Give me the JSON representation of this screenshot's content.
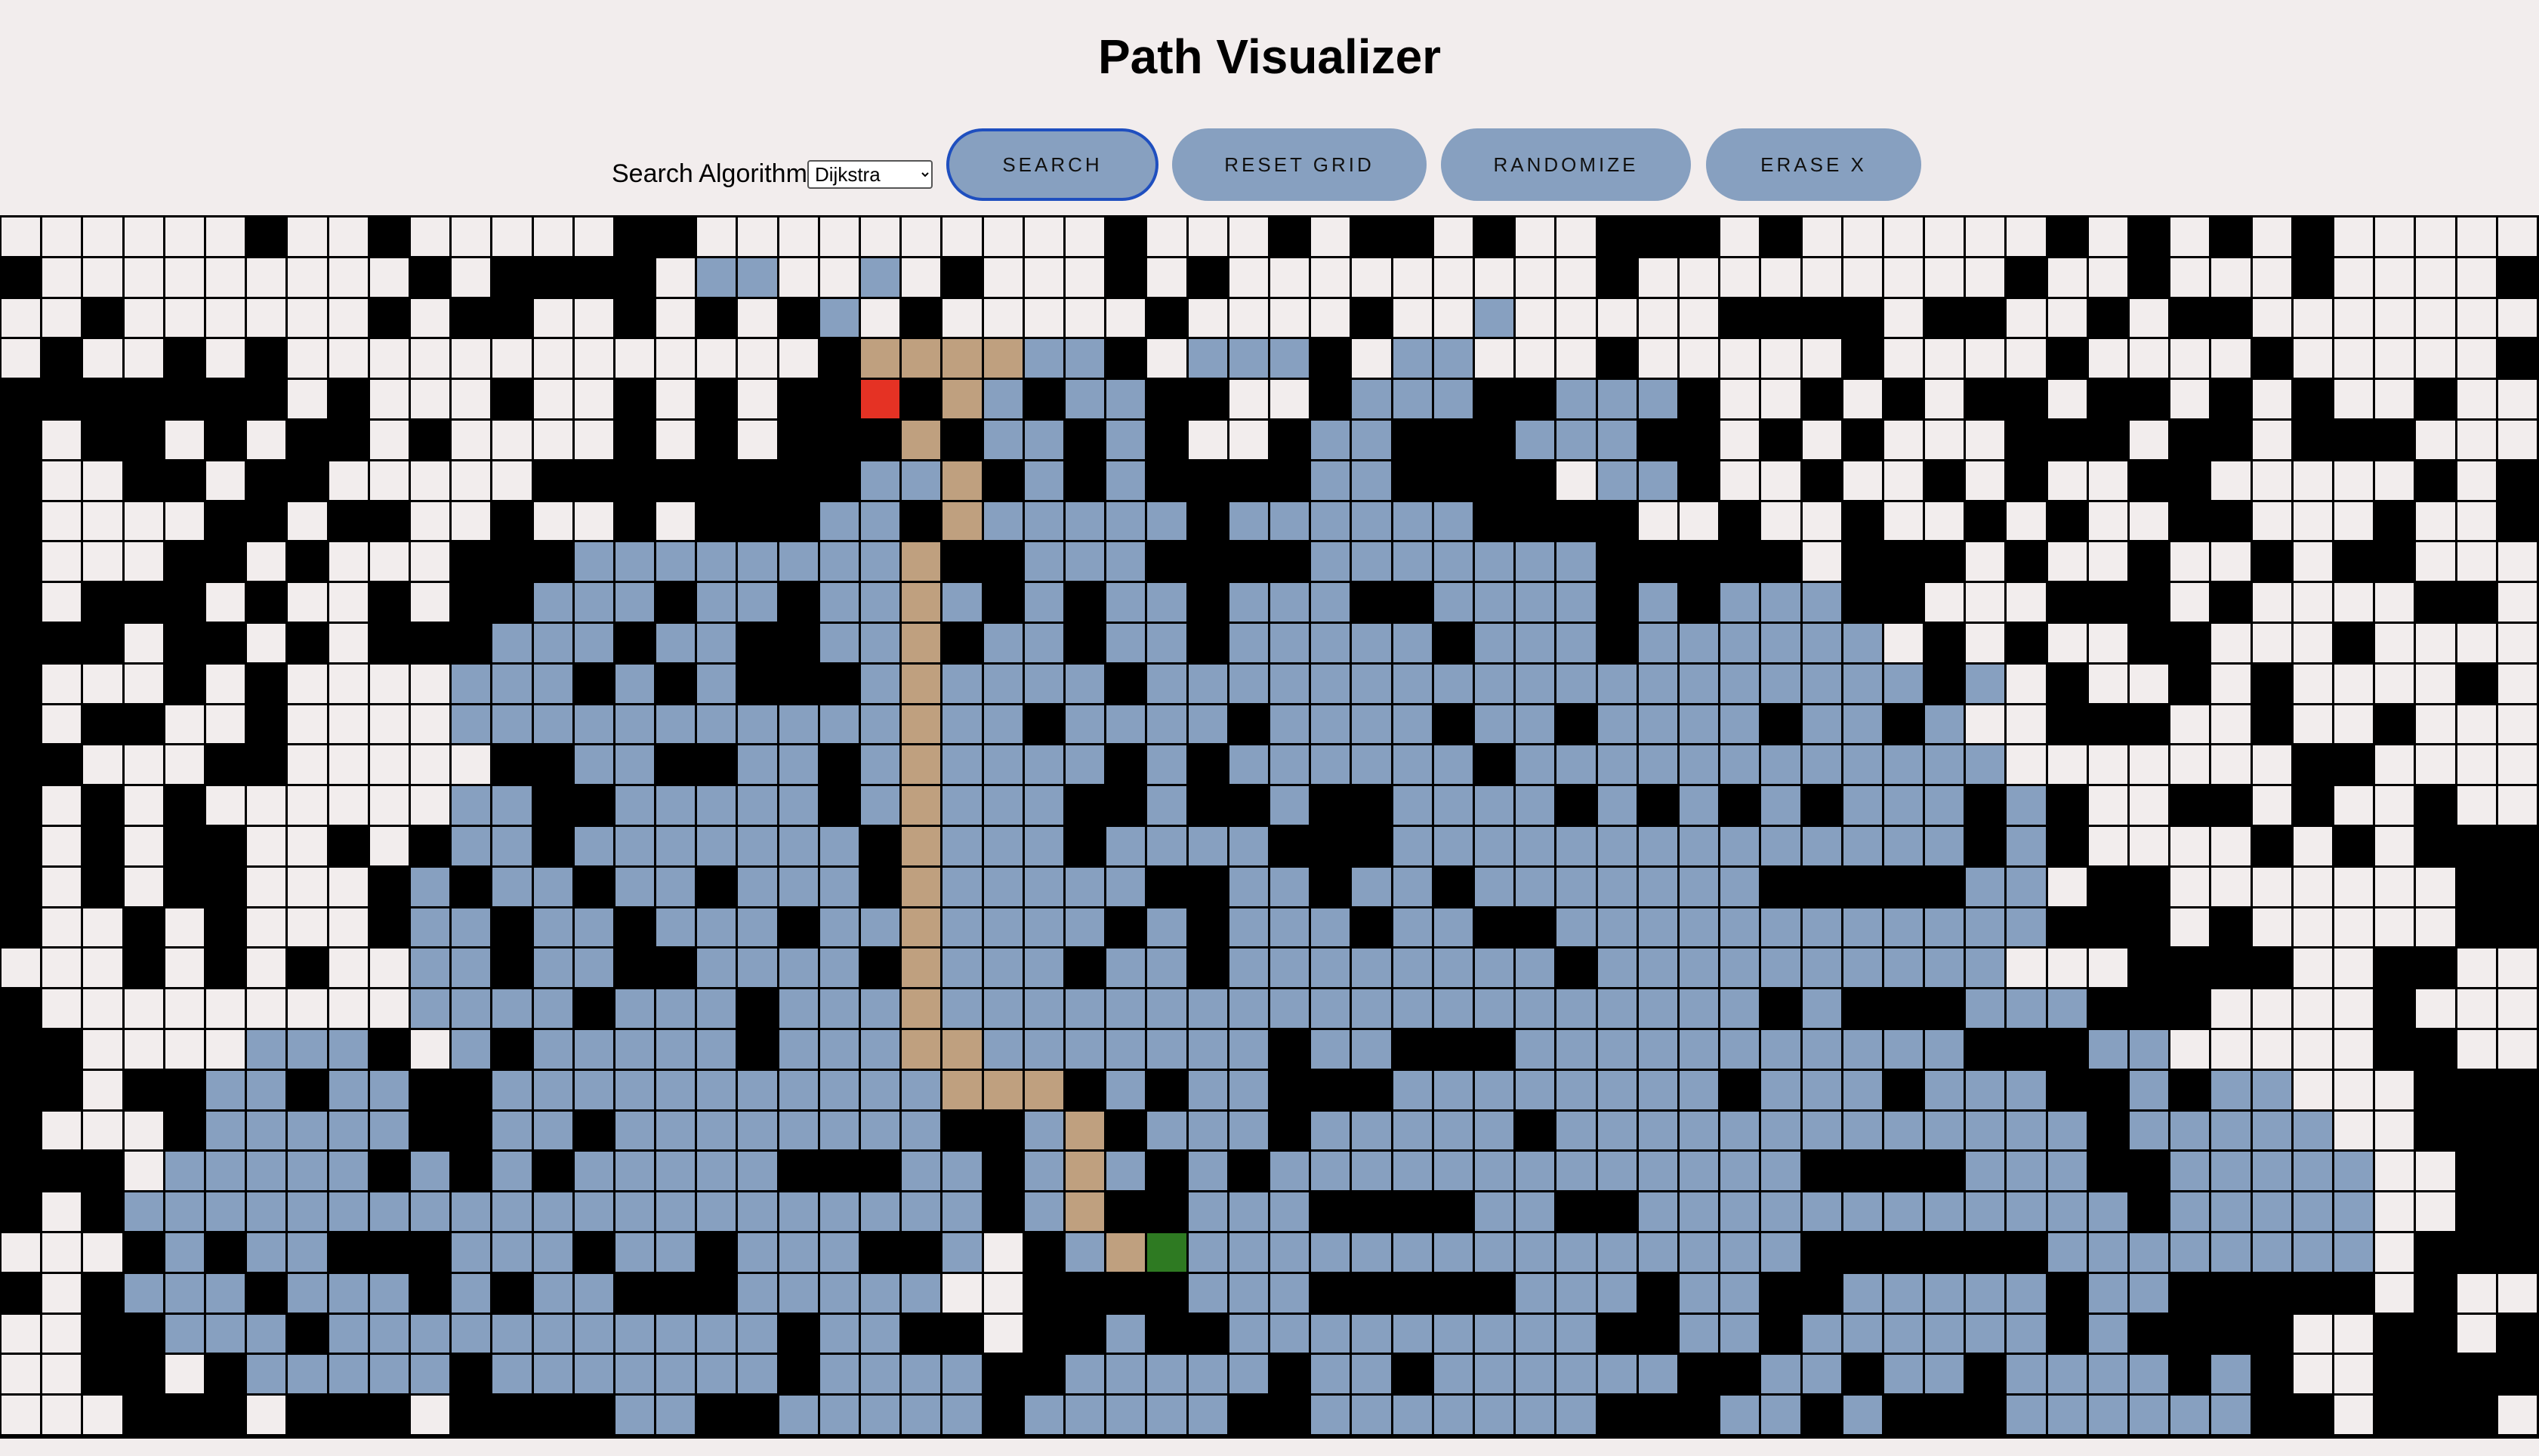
{
  "title": "Path Visualizer",
  "controls": {
    "algorithm_label": "Search Algorithm:",
    "algorithm_selected": "Dijkstra",
    "search_label": "SEARCH",
    "reset_label": "RESET GRID",
    "randomize_label": "RANDOMIZE",
    "erase_label": "ERASE X"
  },
  "legend_colors": {
    "empty": "#f2eded",
    "wall": "#000000",
    "visited": "#87a0c0",
    "path": "#bfa07f",
    "start": "#e53224",
    "target": "#2e7a22",
    "button": "#87a0c0"
  },
  "grid": {
    "columns": 62,
    "rows": 30,
    "cells": [
      "......#..#.....ww..........W...W.WW.W..WWW.W......W.W.W.W.....",
      "W.........W.WWWW.VV..V.W...W.W.........W.........W..W...W....W",
      "..W......W.WW..W.W.WV.W.....W....W..V.....WWWW.WW..W.WW.......",
      ".W..W.W.............WppppVVW.VVVW.VV...W.....W....W....W.....W.",
      "WWWWWWW.W...W..W.W.WWsWpVWVVWW..WVVVWWVVVW..W.W.WW.WW.W.W..W..",
      "W.WW.W.WW.W....W.W.WWWpWVVWVW..WVVWWWVVVWW.W.W...WWW.WW.WWW...",
      "W..WW.WW.....WWWWWWWWVVpWVWVWWWWVVWWWW.VVW..W..W.W..WW.....W.W",
      "W....WW.WW..W..W.WWWVVWpVVVVVWVVVVVVWWWW..W..W..W.W..WW...W..W",
      "W...WW.W...WWWVVVVVVVVpWWVVVWWWWVVVVVVVWWWWW.WWW.W..W..W.WW...",
      "W.WWW.W..W.WWVVVWVVWVVpVWVWVVWVVVWWVVVVWVWVVVWW...WWW.W....WW.",
      "WWW.WW.W.WWWVVVWVVWWVVpWVVWVVWVVVVVWVVVWVVVVVV.W.W..WW...W....",
      "W...W.W....VVVWVWVWWWVpVVVVWVVVVVVVVVVVVVVVVVVVWV.W..W.W....W.",
      "W.WW..W....VVVVVVVVVVVpVVWVVVVWVVVVWVVWVVVVWVVWV..WWW..W..W...",
      "WW...WW.....WWVVWWVVWVpVVVVWVWVVVVVVWVVVVVVVVVVVV.......WW....",
      "W.W.W......VVWWVVVVVWVpVVVWWVWWVWWVVVVWVWVWVWVVVWVW..WW.W..W..",
      "W.W.WW..W.WVVWVVVVVVVWpVVVWVVVVWWWVVVVVVVVVVVVVVWVW....W.W.WWW",
      "W.W.WW...WVWVVWVVWVVVWpVVVVVWWVVWVVWVVVVVVVWWWWWVV.WW.......WW",
      "W..W.W...WVVWVVWVVVWVVpVVVVWVWVVVWVVWWVVVVVVVVVVVVWWW.W.....WW",
      "...W.W.W..VVWVVWWVVVVWpVVVWVVWVVVVVVVVWVVVVVVVVVV...WWWW..WW..",
      "W.........VVVVWVVVWVVVpVVVVVVVVVVVVVVVVVVVVWVWWWVVVWWW....W...",
      "WW....VVVW.VWVVVVVWVVVppVVVVVVVWVVWWWVVVVVVVVVVVWWWVV.....WW..",
      "WW.WWVVWVVWWVVVVVVVVVVVpppWVWVVWWWVVVVVVVVWVVVWVVVWWVWVV...WWW",
      "W...WVVVVVWWVVWVVVVVVVVWWVpWVVVWVVVVVWVVVVVVVVVVVVVWVVVVV..WWW",
      "WWW.VVVVVWVWVWVVVVVWWWVVWVpVWVWVVVVVVVVVVVVVWWWWVVVWWVVVVV..WW",
      "W.WVVVVVVVVVVVVVVVVVVVVVWVpWWVVVWWWWVVWWVVVVVVVVVVVVWVVVVV..WW",
      "...WVWVVWWWVVVWVVWVVVWWV.WVptVVVVVVVVVVVVVVVWWWWWWVVVVVVVV.WWWW",
      "W.WVVVWVVVWVWVVWWWVVVVV..WWWWVVVWWWWWVVVWVVWWVVVVVWVVWWWWW.W..",
      "..WWVVVWVVVVVVVVVVVWVVWW.WWVWWVVVVVVVVVWWVVWVVVVVVWVWWWW..WW.W",
      "..WW.WVVVVVWVVVVVVVWVVVVWWVVVVVWVVWVVVVVVWWVVWVVWVVVVWVW..WWWW",
      "...WWW.WWW.WWWWVVWWVVVVVWVVVVVWWVVVVVVVWWWVVWVWWWVVVVVVWW.WWW.",
      "..............................................................."
    ]
  }
}
